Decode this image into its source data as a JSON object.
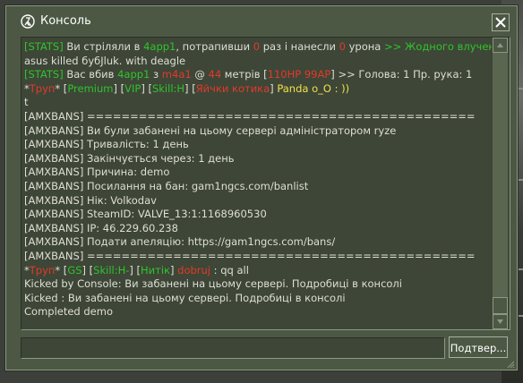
{
  "window": {
    "title": "Консоль",
    "icon": "counter-strike-icon",
    "close_icon": "close-icon"
  },
  "console": {
    "lines": [
      [
        {
          "t": "[STATS]",
          "c": "g"
        },
        {
          "t": " Ви стріляли в ",
          "c": "w"
        },
        {
          "t": "4app1",
          "c": "g"
        },
        {
          "t": ", потрапивши ",
          "c": "w"
        },
        {
          "t": "0",
          "c": "r"
        },
        {
          "t": " раз і нанесли ",
          "c": "w"
        },
        {
          "t": "0",
          "c": "r"
        },
        {
          "t": " урона ",
          "c": "w"
        },
        {
          "t": ">> Жодного влучення",
          "c": "g"
        }
      ],
      [
        {
          "t": "asus killed бyбJluk. with deagle",
          "c": "w"
        }
      ],
      [
        {
          "t": "[STATS]",
          "c": "g"
        },
        {
          "t": " Вас вбив ",
          "c": "w"
        },
        {
          "t": "4app1",
          "c": "g"
        },
        {
          "t": " з ",
          "c": "w"
        },
        {
          "t": "m4a1",
          "c": "r"
        },
        {
          "t": " @ ",
          "c": "w"
        },
        {
          "t": "44",
          "c": "r"
        },
        {
          "t": " метрів [",
          "c": "w"
        },
        {
          "t": "110HP 99AP",
          "c": "r"
        },
        {
          "t": "] >> Голова: 1 Пр. рука: 1",
          "c": "w"
        }
      ],
      [
        {
          "t": "*",
          "c": "w"
        },
        {
          "t": "Труп",
          "c": "r"
        },
        {
          "t": "* [",
          "c": "w"
        },
        {
          "t": "Premium",
          "c": "g"
        },
        {
          "t": "] [",
          "c": "w"
        },
        {
          "t": "VIP",
          "c": "g"
        },
        {
          "t": "] [",
          "c": "w"
        },
        {
          "t": "Skill:H",
          "c": "g"
        },
        {
          "t": "] [",
          "c": "w"
        },
        {
          "t": "Яйчки котика",
          "c": "r"
        },
        {
          "t": "] ",
          "c": "w"
        },
        {
          "t": "Panda o_O : ))",
          "c": "y"
        }
      ],
      [
        {
          "t": " t",
          "c": "w"
        }
      ],
      [
        {
          "t": "[AMXBANS] =============================================",
          "c": "w"
        }
      ],
      [
        {
          "t": "[AMXBANS] Ви були забанені на цьому сервері адміністратором ryze",
          "c": "w"
        }
      ],
      [
        {
          "t": "[AMXBANS] Тривалість: 1 день",
          "c": "w"
        }
      ],
      [
        {
          "t": "[AMXBANS] Закінчується через: 1 день",
          "c": "w"
        }
      ],
      [
        {
          "t": "[AMXBANS] Причина: demo",
          "c": "w"
        }
      ],
      [
        {
          "t": "[AMXBANS] Посилання на бан: gam1ngcs.com/banlist",
          "c": "w"
        }
      ],
      [
        {
          "t": "[AMXBANS] Нік: Volkodav",
          "c": "w"
        }
      ],
      [
        {
          "t": "[AMXBANS] SteamID: VALVE_13:1:1168960530",
          "c": "w"
        }
      ],
      [
        {
          "t": "[AMXBANS] IP: 46.229.60.238",
          "c": "w"
        }
      ],
      [
        {
          "t": "[AMXBANS] Подати апеляцію: https://gam1ngcs.com/bans/",
          "c": "w"
        }
      ],
      [
        {
          "t": "[AMXBANS] =============================================",
          "c": "w"
        }
      ],
      [
        {
          "t": "*",
          "c": "w"
        },
        {
          "t": "Труп",
          "c": "r"
        },
        {
          "t": "* [",
          "c": "w"
        },
        {
          "t": "GS",
          "c": "g"
        },
        {
          "t": "] [",
          "c": "w"
        },
        {
          "t": "Skill:H-",
          "c": "g"
        },
        {
          "t": "] [",
          "c": "w"
        },
        {
          "t": "Нитік",
          "c": "g"
        },
        {
          "t": "] ",
          "c": "w"
        },
        {
          "t": "dobruj",
          "c": "r"
        },
        {
          "t": " : qq all",
          "c": "w"
        }
      ],
      [
        {
          "t": "Kicked by Console:  Ви забанені на цьому сервері. Подробиці в консолі",
          "c": "w"
        }
      ],
      [
        {
          "t": "Kicked : Ви забанені на цьому сервері. Подробиці в консолі",
          "c": "w"
        }
      ],
      [
        {
          "t": "Completed demo",
          "c": "w"
        }
      ]
    ]
  },
  "input": {
    "value": "",
    "submit_label": "Подтвер..."
  },
  "colors": {
    "window_bg": "#4c5844",
    "console_bg": "#3e4637",
    "text": "#dedfd6",
    "green": "#2ec42e",
    "red": "#e23a2a",
    "yellow": "#f0e04a"
  }
}
